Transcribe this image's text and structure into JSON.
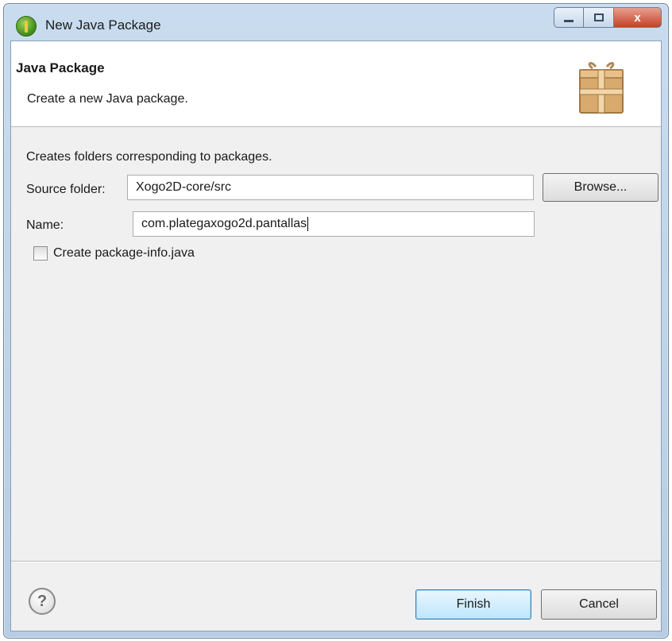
{
  "window": {
    "title": "New Java Package",
    "controls": {
      "minimize": "",
      "maximize": "",
      "close": "x"
    }
  },
  "banner": {
    "title": "Java Package",
    "description": "Create a new Java package.",
    "icon": "package-icon"
  },
  "content": {
    "intro": "Creates folders corresponding to packages.",
    "source_folder": {
      "label": "Source folder:",
      "value": "Xogo2D-core/src"
    },
    "name": {
      "label": "Name:",
      "value": "com.plategaxogo2d.pantallas"
    },
    "browse_label": "Browse...",
    "package_info_checkbox": {
      "label": "Create package-info.java",
      "checked": false
    }
  },
  "footer": {
    "help_icon": "?",
    "finish_label": "Finish",
    "cancel_label": "Cancel"
  }
}
